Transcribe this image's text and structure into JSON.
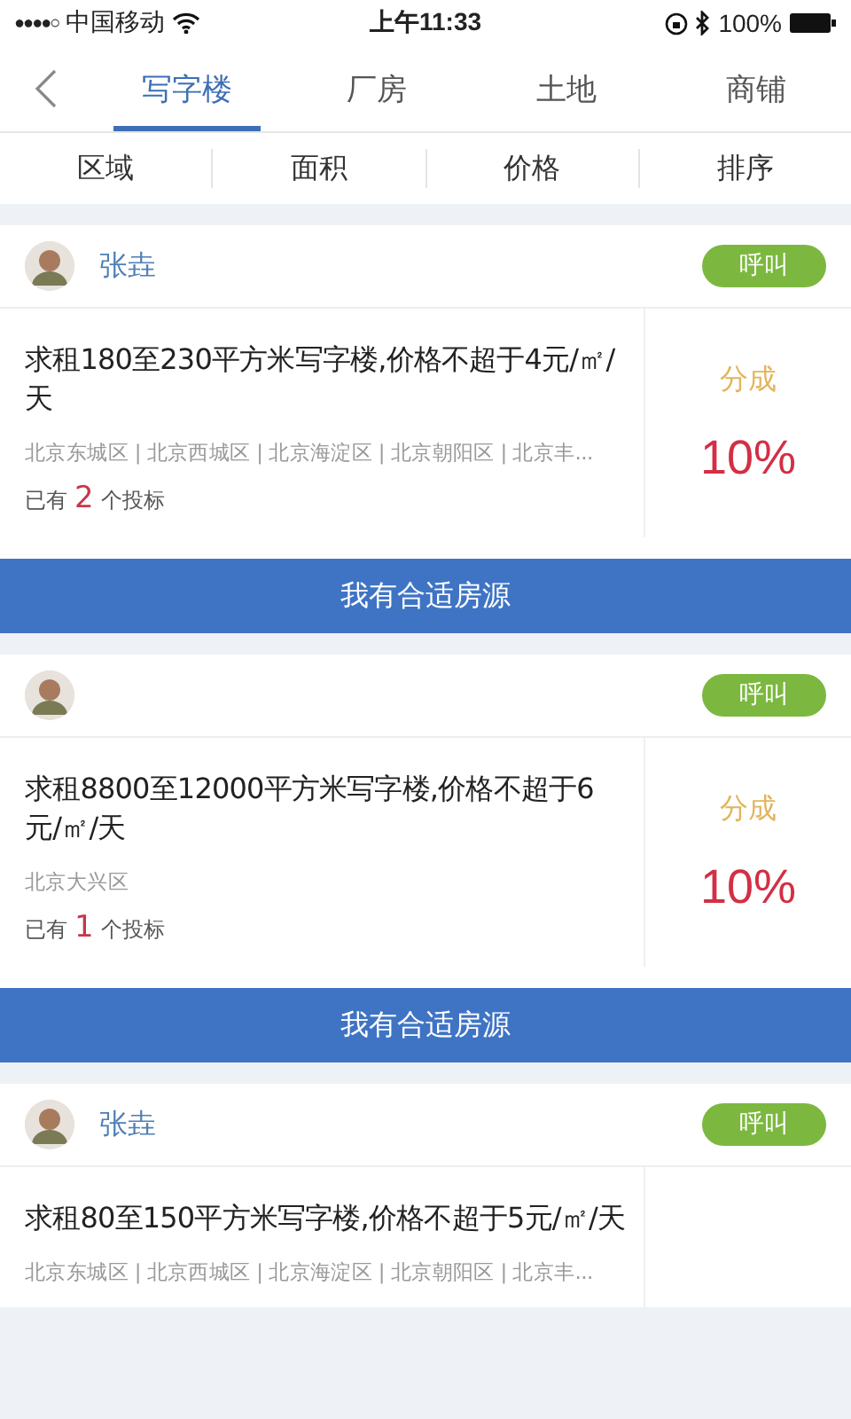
{
  "status_bar": {
    "signal": "●●●●○",
    "carrier": "中国移动",
    "time": "上午11:33",
    "battery": "100%"
  },
  "tabs": [
    {
      "label": "写字楼",
      "selected": true
    },
    {
      "label": "厂房",
      "selected": false
    },
    {
      "label": "土地",
      "selected": false
    },
    {
      "label": "商铺",
      "selected": false
    }
  ],
  "filters": [
    "区域",
    "面积",
    "价格",
    "排序"
  ],
  "listings": [
    {
      "name": "张垚",
      "call": "呼叫",
      "title": "求租180至230平方米写字楼,价格不超于4元/㎡/天",
      "regions": "北京东城区 | 北京西城区 | 北京海淀区 | 北京朝阳区 | 北京丰...",
      "bids_prefix": "已有",
      "bids_count": "2",
      "bids_suffix": "个投标",
      "share_label": "分成",
      "share_value": "10%",
      "action": "我有合适房源"
    },
    {
      "call": "呼叫",
      "title": "求租8800至12000平方米写字楼,价格不超于6元/㎡/天",
      "regions": "北京大兴区",
      "bids_prefix": "已有",
      "bids_count": "1",
      "bids_suffix": "个投标",
      "share_label": "分成",
      "share_value": "10%",
      "action": "我有合适房源"
    },
    {
      "name": "张垚",
      "call": "呼叫",
      "title": "求租80至150平方米写字楼,价格不超于5元/㎡/天",
      "regions": "北京东城区 | 北京西城区 | 北京海淀区 | 北京朝阳区 | 北京丰..."
    }
  ]
}
